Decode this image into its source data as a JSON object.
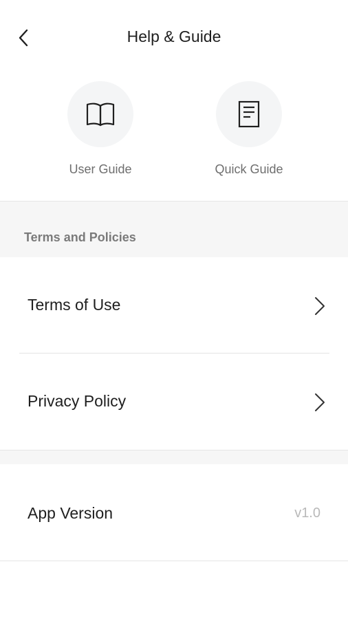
{
  "header": {
    "title": "Help & Guide",
    "back_icon": "chevron-left-icon"
  },
  "guides": [
    {
      "label": "User Guide",
      "icon": "open-book-icon"
    },
    {
      "label": "Quick Guide",
      "icon": "document-icon"
    }
  ],
  "terms_section": {
    "title": "Terms and Policies",
    "items": [
      {
        "label": "Terms of Use",
        "icon": "chevron-right-icon"
      },
      {
        "label": "Privacy Policy",
        "icon": "chevron-right-icon"
      }
    ]
  },
  "app_version": {
    "label": "App Version",
    "value": "v1.0"
  },
  "colors": {
    "background": "#ffffff",
    "section_background": "#f6f6f6",
    "icon_circle": "#f4f5f6",
    "primary_text": "#1f1f1f",
    "secondary_text": "#6e6e6e",
    "muted_text": "#b9b9b9"
  }
}
